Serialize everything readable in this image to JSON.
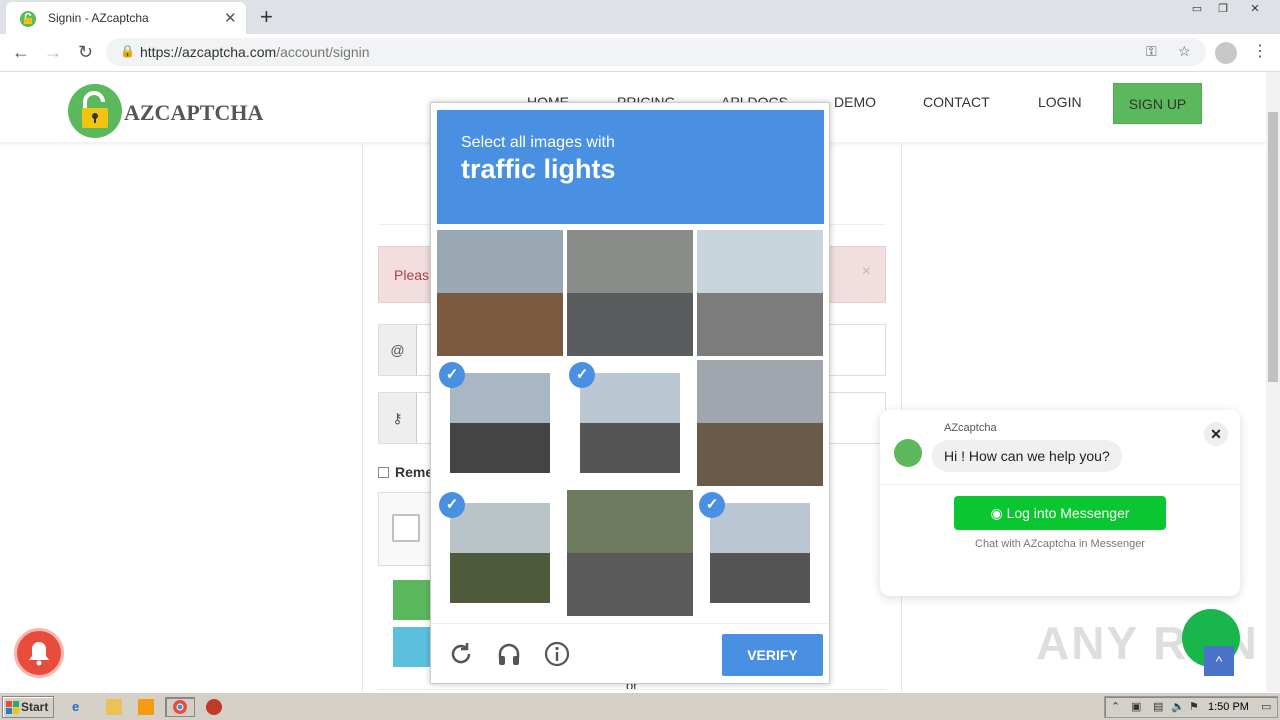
{
  "browser": {
    "tab_title": "Signin - AZcaptcha",
    "url_host": "https://azcaptcha.com",
    "url_path": "/account/signin"
  },
  "site": {
    "logo_text": "AZCAPTCHA",
    "nav": [
      "HOME",
      "PRICING",
      "API DOCS",
      "DEMO",
      "CONTACT",
      "LOGIN"
    ],
    "signup_label": "SIGN UP",
    "alert_text": "Pleas",
    "remember_label": "Reme",
    "or_text": "or"
  },
  "captcha": {
    "instruction": "Select all images with",
    "target": "traffic lights",
    "verify_label": "VERIFY",
    "tiles": [
      {
        "selected": false,
        "scene": "building"
      },
      {
        "selected": false,
        "scene": "gas-station"
      },
      {
        "selected": false,
        "scene": "street"
      },
      {
        "selected": true,
        "scene": "traffic-light"
      },
      {
        "selected": true,
        "scene": "intersection"
      },
      {
        "selected": false,
        "scene": "shops"
      },
      {
        "selected": true,
        "scene": "traffic-light-trees"
      },
      {
        "selected": false,
        "scene": "road-motorbike"
      },
      {
        "selected": true,
        "scene": "intersection"
      }
    ]
  },
  "messenger": {
    "name": "AZcaptcha",
    "greeting": "Hi ! How can we help you?",
    "button_label": "Log into Messenger",
    "subtext": "Chat with AZcaptcha in Messenger"
  },
  "watermark": "ANY RUN",
  "taskbar": {
    "start_label": "Start",
    "clock": "1:50 PM"
  },
  "colors": {
    "captcha_blue": "#4a90e2",
    "brand_green": "#5cb85c",
    "messenger_green": "#0ac630"
  }
}
